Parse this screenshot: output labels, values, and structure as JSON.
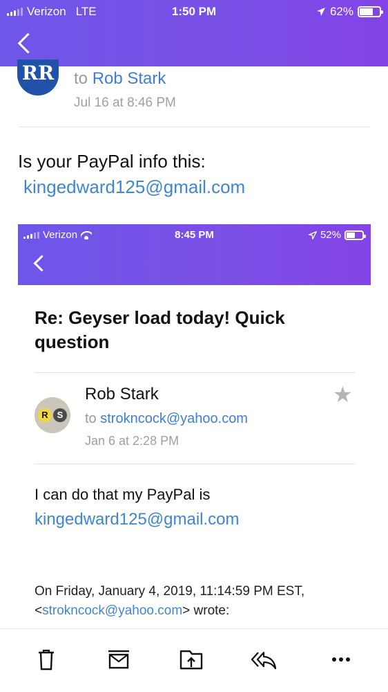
{
  "status_bar": {
    "carrier": "Verizon",
    "network": "LTE",
    "time": "1:50 PM",
    "battery": "62%",
    "battery_level": 0.62
  },
  "outer_email": {
    "avatar_initials": "RR",
    "to_prefix": "to",
    "to_name": "Rob Stark",
    "date": "Jul 16 at 8:46 PM",
    "body_text": "Is your PayPal info this:",
    "body_link": "kingedward125@gmail.com"
  },
  "embedded_screenshot": {
    "status_bar": {
      "carrier": "Verizon",
      "time": "8:45 PM",
      "battery": "52%",
      "battery_level": 0.52
    },
    "subject": "Re: Geyser load today! Quick question",
    "sender_name": "Rob Stark",
    "avatar_letters": [
      "R",
      "S"
    ],
    "to_prefix": "to",
    "to_address": "strokncock@yahoo.com",
    "date": "Jan 6 at 2:28 PM",
    "reply_text": "I can do that my PayPal is",
    "reply_link": "kingedward125@gmail.com",
    "quote_line1": "On Friday, January 4, 2019, 11:14:59 PM EST,",
    "quote_open": "<",
    "quote_address": "strokncock@yahoo.com",
    "quote_close": "> wrote:"
  },
  "colors": {
    "header_gradient_start": "#6e56e8",
    "header_gradient_end": "#8443e6",
    "link": "#3d86d6",
    "avatar_blue": "#1f52a8"
  },
  "toolbar": {
    "icons": [
      "trash-icon",
      "archive-icon",
      "move-to-folder-icon",
      "reply-all-icon",
      "more-icon"
    ]
  }
}
